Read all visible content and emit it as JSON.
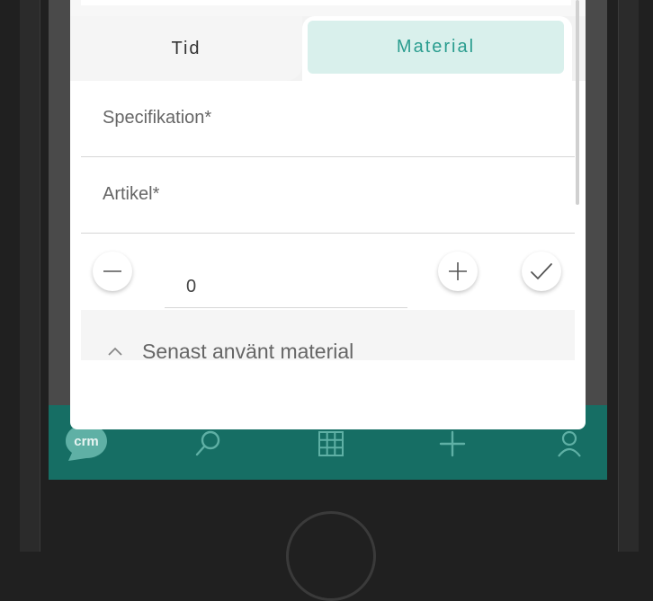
{
  "tabs": {
    "tid_label": "Tid",
    "material_label": "Material",
    "active": "Material"
  },
  "form": {
    "specification_label": "Specifikation*",
    "article_label": "Artikel*",
    "quantity_value": "0"
  },
  "recent": {
    "label": "Senast använt material"
  },
  "bottom_nav": {
    "logo_text": "crm",
    "items": [
      "search-icon",
      "grid-icon",
      "plus-icon",
      "user-icon"
    ]
  },
  "colors": {
    "accent": "#2a9d8f",
    "tab_active_bg": "#d9f0ec",
    "nav_bg": "#166e64"
  }
}
